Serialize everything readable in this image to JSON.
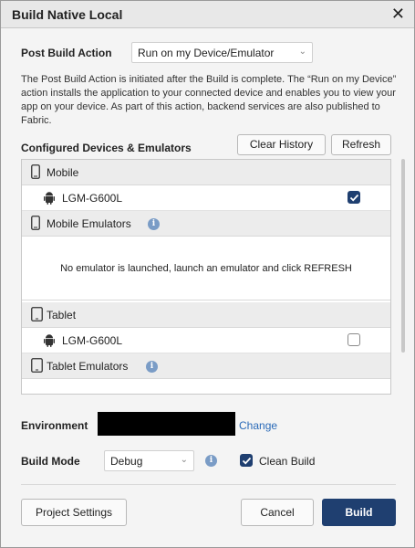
{
  "dialog": {
    "title": "Build Native Local",
    "close_glyph": "✕"
  },
  "post_build": {
    "label": "Post Build Action",
    "selected": "Run on my Device/Emulator",
    "description": "The Post Build Action is initiated after the Build is complete. The “Run on my Device” action installs the application to your connected device and enables you to view your app on your device. As part of this action, backend services are also published to Fabric."
  },
  "devices": {
    "label": "Configured Devices & Emulators",
    "clear_history": "Clear History",
    "refresh": "Refresh",
    "groups": {
      "mobile": {
        "label": "Mobile",
        "icon": "phone-icon"
      },
      "mobile_device": {
        "label": "LGM-G600L",
        "icon": "android-icon",
        "checked": true
      },
      "mobile_emulators": {
        "label": "Mobile Emulators",
        "icon": "phone-icon",
        "info": "i"
      },
      "empty_message": "No emulator is launched, launch an emulator and click REFRESH",
      "tablet": {
        "label": "Tablet",
        "icon": "tablet-icon"
      },
      "tablet_device": {
        "label": "LGM-G600L",
        "icon": "android-icon",
        "checked": false
      },
      "tablet_emulators": {
        "label": "Tablet Emulators",
        "icon": "tablet-icon",
        "info": "i"
      }
    }
  },
  "environment": {
    "label": "Environment",
    "change": "Change"
  },
  "build_mode": {
    "label": "Build Mode",
    "selected": "Debug",
    "info": "i",
    "clean_build_label": "Clean Build",
    "clean_build_checked": true
  },
  "footer": {
    "project_settings": "Project Settings",
    "cancel": "Cancel",
    "build": "Build"
  },
  "colors": {
    "primary": "#1f3f70",
    "link": "#2a6ab8",
    "info": "#7a9cc6"
  }
}
